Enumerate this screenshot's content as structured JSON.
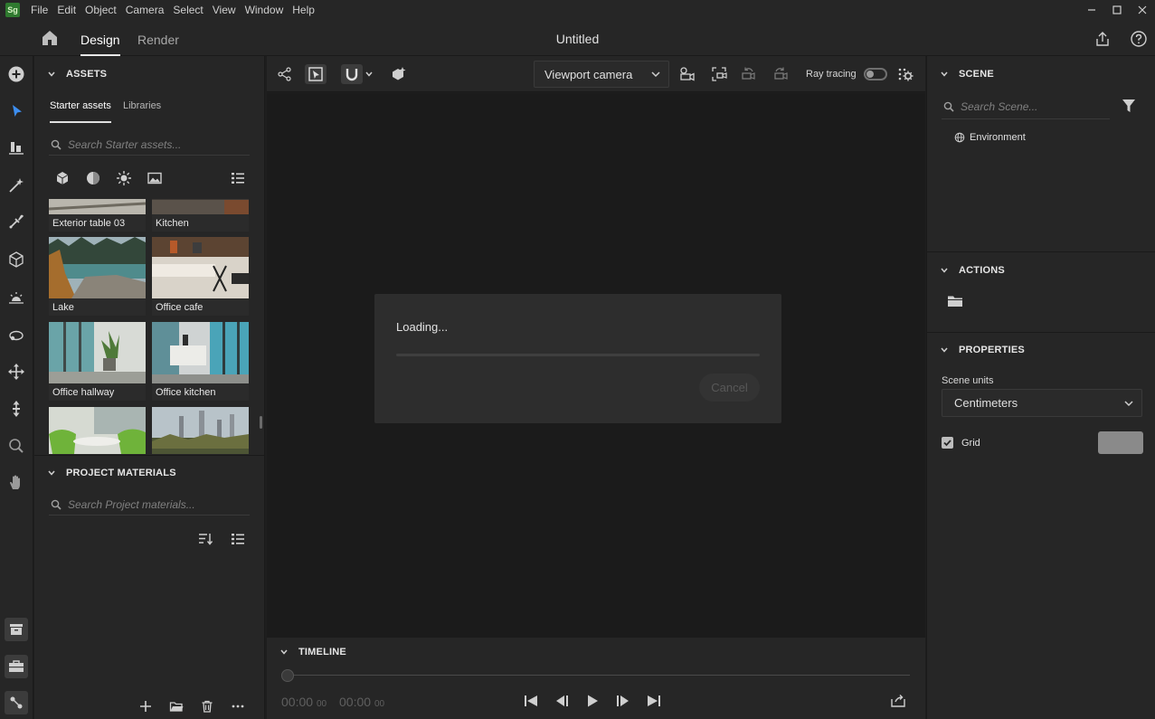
{
  "app": {
    "logo_text": "Sg",
    "title": "Untitled"
  },
  "menu": [
    "File",
    "Edit",
    "Object",
    "Camera",
    "Select",
    "View",
    "Window",
    "Help"
  ],
  "header": {
    "tab_design": "Design",
    "tab_render": "Render"
  },
  "assets": {
    "title": "ASSETS",
    "tab_starter": "Starter assets",
    "tab_libraries": "Libraries",
    "search_placeholder": "Search Starter assets...",
    "tiles": [
      {
        "label": "Exterior table 03"
      },
      {
        "label": "Kitchen"
      },
      {
        "label": "Lake"
      },
      {
        "label": "Office cafe"
      },
      {
        "label": "Office hallway"
      },
      {
        "label": "Office kitchen"
      },
      {
        "label": ""
      },
      {
        "label": ""
      }
    ]
  },
  "project_materials": {
    "title": "PROJECT MATERIALS",
    "search_placeholder": "Search Project materials..."
  },
  "viewport": {
    "camera_select": "Viewport camera",
    "ray_tracing_label": "Ray tracing",
    "ray_tracing_on": false
  },
  "loading": {
    "text": "Loading...",
    "progress": 0,
    "cancel_label": "Cancel"
  },
  "timeline": {
    "title": "TIMELINE",
    "current_main": "00:00",
    "current_frac": "00",
    "end_main": "00:00",
    "end_frac": "00"
  },
  "scene": {
    "title": "SCENE",
    "search_placeholder": "Search Scene...",
    "items": [
      "Environment"
    ]
  },
  "actions": {
    "title": "ACTIONS"
  },
  "properties": {
    "title": "PROPERTIES",
    "units_label": "Scene units",
    "units_value": "Centimeters",
    "grid_label": "Grid",
    "grid_checked": true,
    "grid_color": "#8a8a8a"
  },
  "colors": {
    "accent": "#3d8ef0",
    "panel": "#262626",
    "viewport": "#1b1b1b"
  }
}
